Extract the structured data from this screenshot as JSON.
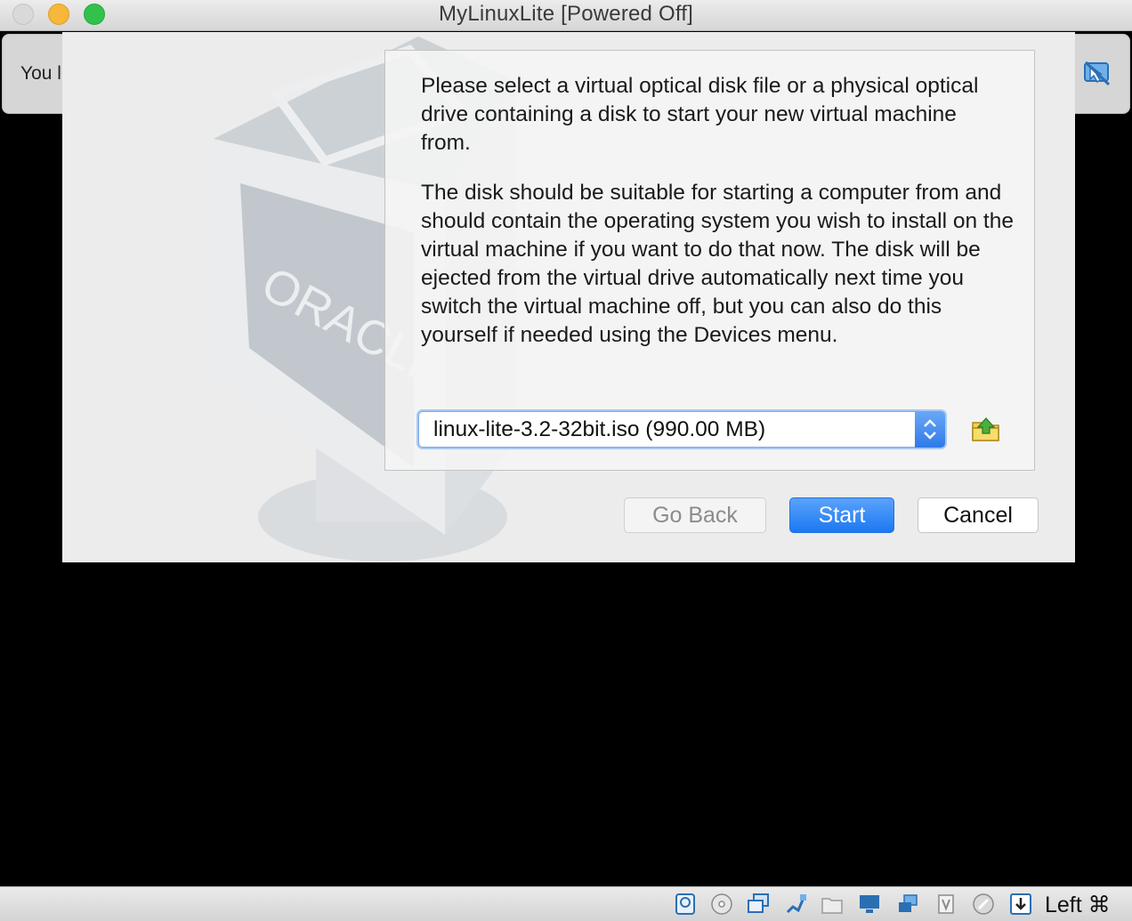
{
  "window": {
    "title": "MyLinuxLite [Powered Off]"
  },
  "notification": {
    "text": "You l"
  },
  "dialog": {
    "watermark_text": "ORACLE",
    "paragraph1": "Please select a virtual optical disk file or a physical optical drive containing a disk to start your new virtual machine from.",
    "paragraph2": "The disk should be suitable for starting a computer from and should contain the operating system you wish to install on the virtual machine if you want to do that now. The disk will be ejected from the virtual drive automatically next time you switch the virtual machine off, but you can also do this yourself if needed using the Devices menu.",
    "disk_select": {
      "value": "linux-lite-3.2-32bit.iso (990.00 MB)"
    },
    "buttons": {
      "back": "Go Back",
      "start": "Start",
      "cancel": "Cancel"
    }
  },
  "statusbar": {
    "icons": [
      "hard-disk-icon",
      "optical-drive-icon",
      "network-icon",
      "usb-icon",
      "shared-folders-icon",
      "display-icon",
      "video-capture-icon",
      "cpu-icon",
      "mouse-integration-icon",
      "keyboard-capture-icon"
    ],
    "host_key": "Left ⌘"
  }
}
